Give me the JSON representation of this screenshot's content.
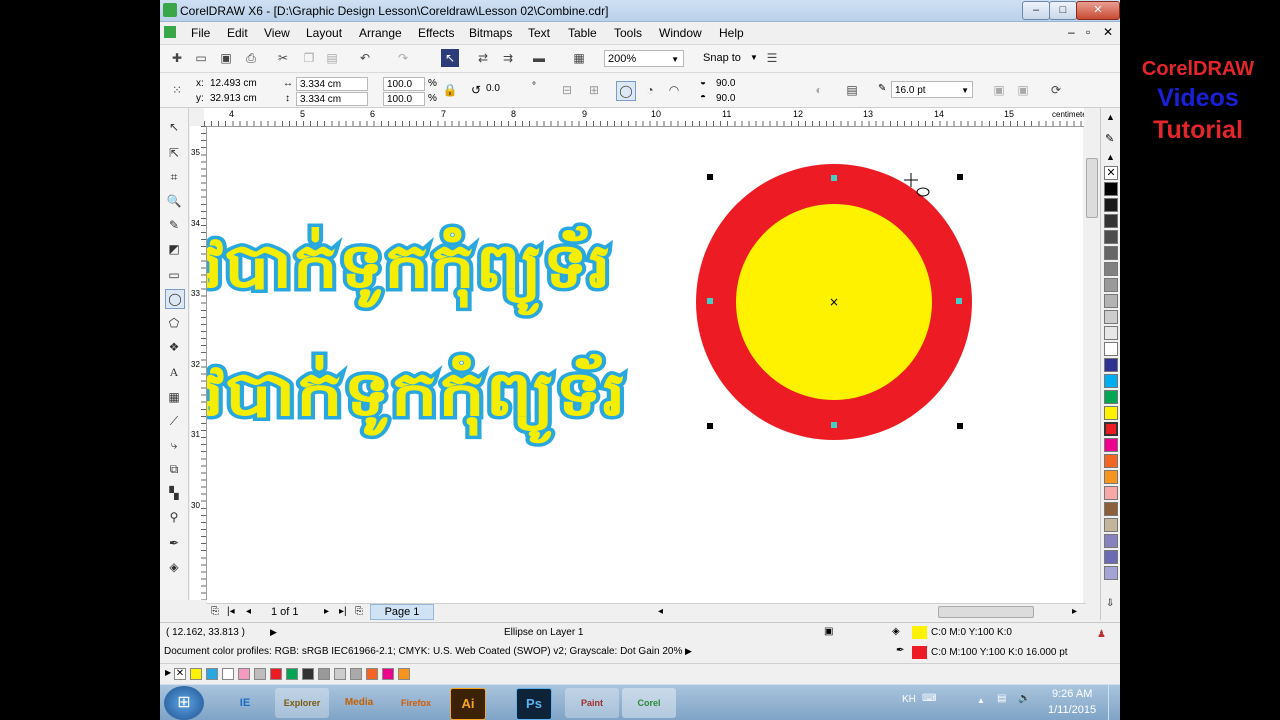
{
  "window": {
    "title": "CorelDRAW X6 - [D:\\Graphic Design Lesson\\Coreldraw\\Lesson 02\\Combine.cdr]",
    "minimize": "–",
    "maximize": "□",
    "close": "✕"
  },
  "menu": [
    "File",
    "Edit",
    "View",
    "Layout",
    "Arrange",
    "Effects",
    "Bitmaps",
    "Text",
    "Table",
    "Tools",
    "Window",
    "Help"
  ],
  "menu_controls": {
    "min": "–",
    "restore": "▫",
    "close": "✕"
  },
  "toolbar": {
    "zoom": "200%",
    "snap_to": "Snap to"
  },
  "properties": {
    "x": "12.493 cm",
    "y": "32.913 cm",
    "width": "3.334 cm",
    "height": "3.334 cm",
    "scale_x": "100.0",
    "scale_y": "100.0",
    "pct": "%",
    "rotation": "0.0",
    "degree": "°",
    "start_angle": "90.0",
    "end_angle": "90.0",
    "outline_width": "16.0 pt"
  },
  "ruler": {
    "h_ticks": [
      "4",
      "5",
      "6",
      "7",
      "8",
      "9",
      "10",
      "11",
      "12",
      "13",
      "14",
      "15"
    ],
    "unit": "centimeters",
    "v_ticks": [
      "35",
      "34",
      "33",
      "32",
      "31",
      "30"
    ],
    "v_unit": "centimeters"
  },
  "canvas": {
    "text_line_1": "វបាក់ទូកកុំព្យូទ័រ",
    "text_line_2": "វបាក់ទូកកុំព្យូទ័រ",
    "colors": {
      "text_fill": "#29a8e0",
      "text_outline": "#f5ee00",
      "ring": "#ed1c24",
      "center": "#fff200"
    }
  },
  "page_nav": {
    "count": "1 of 1",
    "tab": "Page 1"
  },
  "status": {
    "coords": "( 12.162, 33.813 )",
    "object": "Ellipse on Layer 1",
    "fill": "C:0 M:0 Y:100 K:0",
    "outline": "C:0 M:100 Y:100 K:0  16.000 pt",
    "profiles": "Document color profiles: RGB: sRGB IEC61966-2.1; CMYK: U.S. Web Coated (SWOP) v2; Grayscale: Dot Gain 20%",
    "fill_color": "#fff200",
    "outline_color": "#ed1c24"
  },
  "palette": [
    "#ffffff",
    "#000000",
    "#333333",
    "#4d4d4d",
    "#666666",
    "#808080",
    "#999999",
    "#b3b3b3",
    "#cccccc",
    "#e6e6e6",
    "#ffffff",
    "#2e3192",
    "#00aeef",
    "#00a651",
    "#fff200",
    "#ed1c24",
    "#ec008c",
    "#f26522",
    "#f7941d",
    "#f9a8a8",
    "#8b5e3c",
    "#c2b59b",
    "#8781bd",
    "#6a6bb3",
    "#a3a3d6"
  ],
  "doc_palette": [
    "#fff200",
    "#29a8e0",
    "#ffffff",
    "#f49ac1",
    "#bdbdbd",
    "#ed1c24",
    "#00a651",
    "#333333",
    "#999999",
    "#cccccc",
    "#aaaaaa",
    "#f26522",
    "#ec008c",
    "#f7941d"
  ],
  "taskbar": {
    "apps": [
      "IE",
      "Explorer",
      "Media",
      "Firefox",
      "Ai",
      "Ps",
      "Paint",
      "Corel"
    ],
    "lang": "KH",
    "time": "9:26 AM",
    "date": "1/11/2015"
  },
  "overlay": {
    "line1": "CorelDRAW",
    "line2": "Videos",
    "line3": "Tutorial"
  }
}
